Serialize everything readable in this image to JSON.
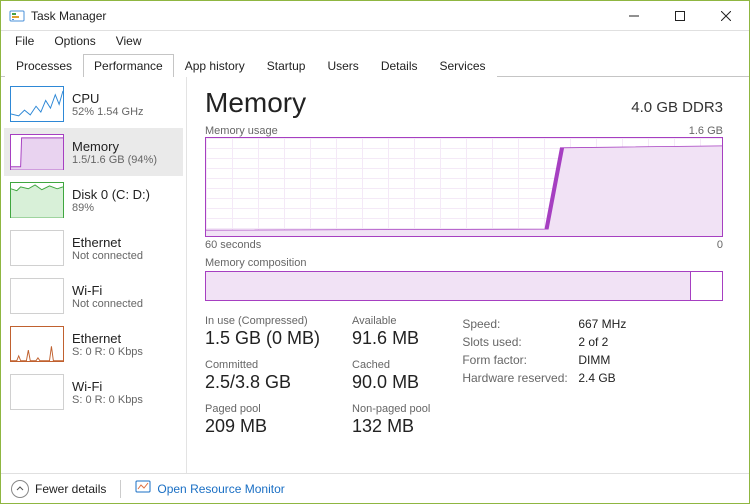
{
  "window": {
    "title": "Task Manager"
  },
  "menu": {
    "file": "File",
    "options": "Options",
    "view": "View"
  },
  "tabs": {
    "processes": "Processes",
    "performance": "Performance",
    "app_history": "App history",
    "startup": "Startup",
    "users": "Users",
    "details": "Details",
    "services": "Services"
  },
  "sidebar": {
    "cpu": {
      "name": "CPU",
      "sub": "52%  1.54 GHz"
    },
    "memory": {
      "name": "Memory",
      "sub": "1.5/1.6 GB (94%)"
    },
    "disk": {
      "name": "Disk 0 (C: D:)",
      "sub": "89%"
    },
    "ethernet": {
      "name": "Ethernet",
      "sub": "Not connected"
    },
    "wifi": {
      "name": "Wi-Fi",
      "sub": "Not connected"
    },
    "ethernet2": {
      "name": "Ethernet",
      "sub": "S: 0  R: 0 Kbps"
    },
    "wifi2": {
      "name": "Wi-Fi",
      "sub": "S: 0  R: 0 Kbps"
    }
  },
  "memory": {
    "title": "Memory",
    "capacity": "4.0 GB DDR3",
    "usage_label": "Memory usage",
    "usage_max": "1.6 GB",
    "axis_left": "60 seconds",
    "axis_right": "0",
    "comp_label": "Memory composition",
    "stats": {
      "in_use_label": "In use (Compressed)",
      "in_use": "1.5 GB (0 MB)",
      "available_label": "Available",
      "available": "91.6 MB",
      "committed_label": "Committed",
      "committed": "2.5/3.8 GB",
      "cached_label": "Cached",
      "cached": "90.0 MB",
      "paged_label": "Paged pool",
      "paged": "209 MB",
      "nonpaged_label": "Non-paged pool",
      "nonpaged": "132 MB"
    },
    "kv": {
      "speed_k": "Speed:",
      "speed_v": "667 MHz",
      "slots_k": "Slots used:",
      "slots_v": "2 of 2",
      "form_k": "Form factor:",
      "form_v": "DIMM",
      "hw_k": "Hardware reserved:",
      "hw_v": "2.4 GB"
    }
  },
  "footer": {
    "fewer": "Fewer details",
    "resmon": "Open Resource Monitor"
  },
  "chart_data": {
    "type": "line",
    "title": "Memory usage",
    "xlabel": "seconds ago",
    "ylabel": "GB",
    "ylim": [
      0,
      1.6
    ],
    "xlim": [
      60,
      0
    ],
    "x": [
      60,
      58,
      56,
      54,
      52,
      50,
      48,
      46,
      44,
      42,
      40,
      38,
      36,
      34,
      32,
      30,
      28,
      26,
      24,
      22,
      20,
      18,
      16,
      14,
      12,
      10,
      8,
      6,
      4,
      2,
      0
    ],
    "values": [
      0.1,
      0.1,
      0.1,
      0.1,
      0.1,
      0.11,
      0.11,
      0.11,
      0.11,
      0.11,
      0.12,
      0.12,
      0.12,
      0.12,
      0.12,
      0.13,
      0.13,
      0.13,
      0.13,
      0.14,
      0.14,
      1.45,
      1.46,
      1.47,
      1.48,
      1.48,
      1.49,
      1.49,
      1.5,
      1.5,
      1.5
    ]
  },
  "composition_data": {
    "type": "bar",
    "title": "Memory composition",
    "total_gb": 1.6,
    "in_use_gb": 1.5,
    "fill_percent": 94
  }
}
